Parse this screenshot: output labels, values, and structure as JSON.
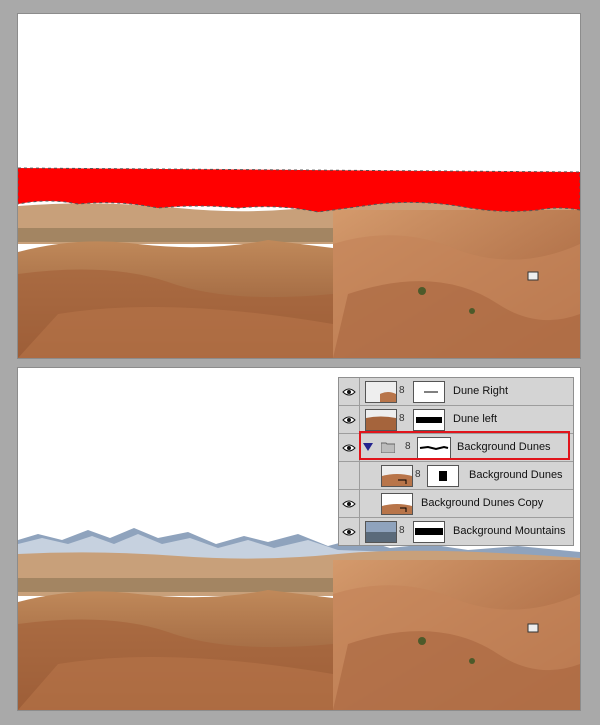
{
  "canvas_top": {
    "description": "document canvas with red selection above desert dunes"
  },
  "canvas_bottom": {
    "description": "document canvas with mountains behind desert dunes"
  },
  "layers_panel": {
    "layers": [
      {
        "name": "Dune Right",
        "visible": true,
        "has_mask": true,
        "mask": "thin-line"
      },
      {
        "name": "Dune left",
        "visible": true,
        "has_mask": true,
        "mask": "bar"
      },
      {
        "name": "Background Dunes",
        "visible": true,
        "type": "group",
        "expanded": true,
        "selected": true,
        "mask": "horizon"
      },
      {
        "name": "Background Dunes",
        "visible": false,
        "indented": true,
        "has_mask": true,
        "mask": "block"
      },
      {
        "name": "Background Dunes Copy",
        "visible": true,
        "indented": true,
        "has_mask": false
      },
      {
        "name": "Background Mountains",
        "visible": true,
        "has_mask": true,
        "mask": "band"
      }
    ]
  },
  "colors": {
    "selection_fill": "#ff0000",
    "highlight_border": "#e1141b",
    "panel_bg": "#d4d4d4",
    "page_bg": "#a9a9a9"
  }
}
